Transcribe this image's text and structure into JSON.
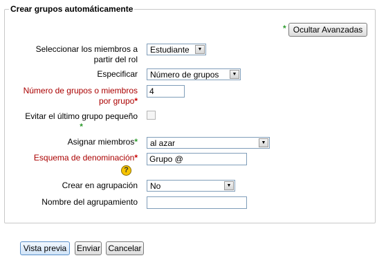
{
  "form": {
    "legend": "Crear grupos automáticamente",
    "advanced_toggle": {
      "marker": "*",
      "label": "Ocultar Avanzadas"
    },
    "fields": {
      "role": {
        "label_line1": "Seleccionar los miembros a",
        "label_line2": "partir del rol",
        "value": "Estudiante"
      },
      "specify": {
        "label": "Especificar",
        "value": "Número de grupos"
      },
      "number": {
        "label_line1": "Número de grupos o miembros",
        "label_line2": "por grupo",
        "required_marker": "*",
        "value": "4"
      },
      "nosmall": {
        "label": "Evitar el último grupo pequeño",
        "advanced_marker": "*",
        "checked": false
      },
      "allocation": {
        "label": "Asignar miembros",
        "advanced_marker": "*",
        "value": "al azar"
      },
      "naming": {
        "label": "Esquema de denominación",
        "required_marker": "*",
        "value": "Grupo @",
        "help_icon": "question-mark-icon"
      },
      "grouping": {
        "label": "Crear en agrupación",
        "value": "No"
      },
      "grouping_name": {
        "label": "Nombre del agrupamiento",
        "value": ""
      }
    }
  },
  "buttons": {
    "preview": "Vista previa",
    "submit": "Enviar",
    "cancel": "Cancelar"
  },
  "colors": {
    "required": "#aa0000",
    "advanced": "#2b9a2b",
    "border": "#c8c8c8"
  }
}
